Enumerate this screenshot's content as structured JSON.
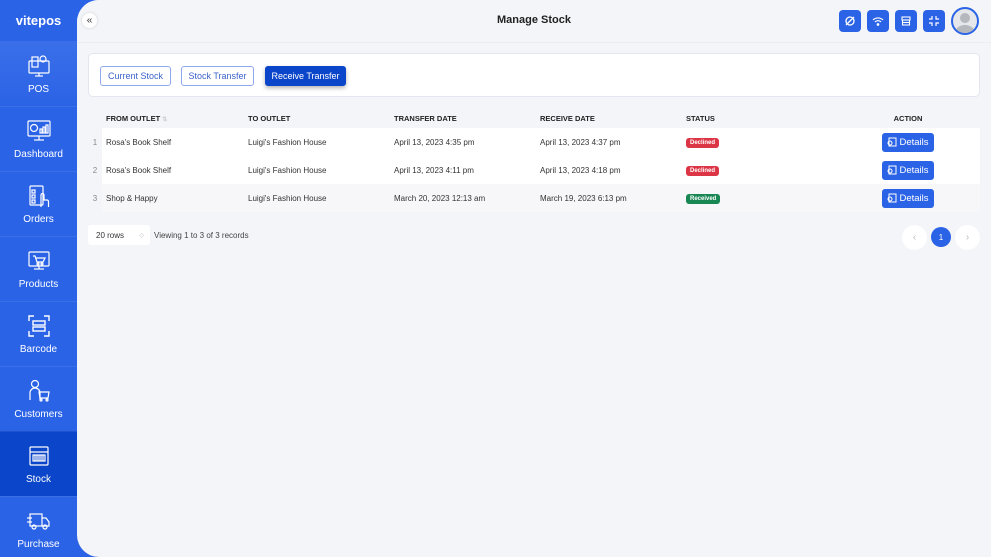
{
  "app": {
    "logo": "vitepos"
  },
  "sidebar": {
    "items": [
      {
        "label": "POS",
        "icon": "pos-terminal-icon"
      },
      {
        "label": "Dashboard",
        "icon": "dashboard-monitor-icon"
      },
      {
        "label": "Orders",
        "icon": "orders-clipboard-icon"
      },
      {
        "label": "Products",
        "icon": "products-cart-icon"
      },
      {
        "label": "Barcode",
        "icon": "barcode-scan-icon"
      },
      {
        "label": "Customers",
        "icon": "customers-cart-icon"
      },
      {
        "label": "Stock",
        "icon": "stock-box-icon",
        "active": true
      },
      {
        "label": "Purchase",
        "icon": "purchase-truck-icon"
      }
    ]
  },
  "header": {
    "title": "Manage Stock",
    "icons": [
      "sync-icon",
      "wifi-icon",
      "store-icon",
      "fullscreen-exit-icon",
      "user-avatar"
    ]
  },
  "tabs": [
    {
      "label": "Current Stock",
      "active": false
    },
    {
      "label": "Stock Transfer",
      "active": false
    },
    {
      "label": "Receive Transfer",
      "active": true
    }
  ],
  "table": {
    "columns": [
      "FROM OUTLET",
      "TO OUTLET",
      "TRANSFER DATE",
      "RECEIVE DATE",
      "STATUS",
      "ACTION"
    ],
    "rows": [
      {
        "num": "1",
        "from": "Rosa's Book Shelf",
        "to": "Luigi's Fashion House",
        "transfer_date": "April 13, 2023 4:35 pm",
        "receive_date": "April 13, 2023 4:37 pm",
        "status": "Declined",
        "action": "Details"
      },
      {
        "num": "2",
        "from": "Rosa's Book Shelf",
        "to": "Luigi's Fashion House",
        "transfer_date": "April 13, 2023 4:11 pm",
        "receive_date": "April 13, 2023 4:18 pm",
        "status": "Declined",
        "action": "Details"
      },
      {
        "num": "3",
        "from": "Shop & Happy",
        "to": "Luigi's Fashion House",
        "transfer_date": "March 20, 2023 12:13 am",
        "receive_date": "March 19, 2023 6:13 pm",
        "status": "Received",
        "action": "Details"
      }
    ]
  },
  "footer": {
    "rows_select": "20 rows",
    "records": "Viewing 1 to 3 of 3 records",
    "prev": "‹",
    "page": "1",
    "next": "›"
  },
  "colors": {
    "primary": "#2b63e6",
    "active_nav": "#0b45c9",
    "declined": "#dc3545",
    "received": "#198754"
  }
}
